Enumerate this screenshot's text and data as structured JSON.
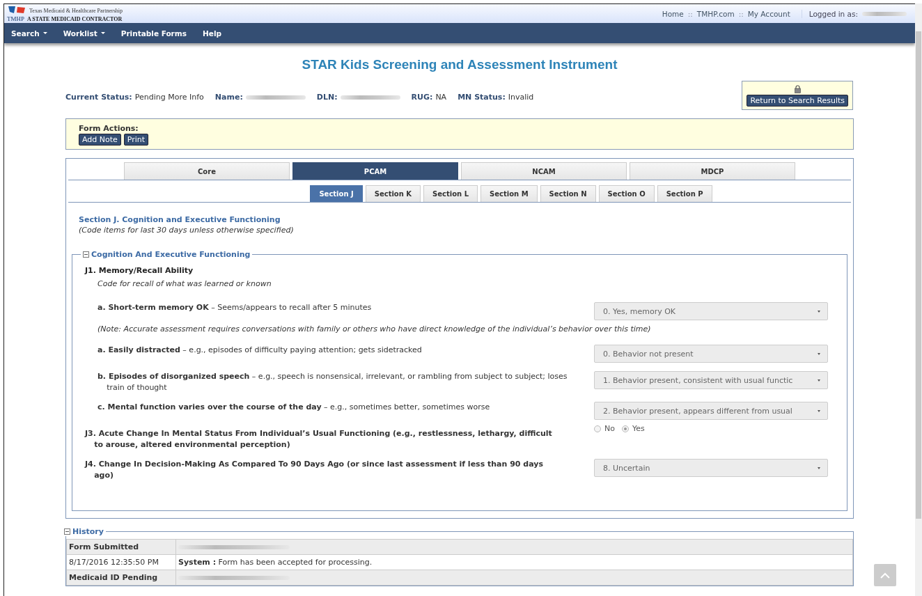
{
  "header": {
    "logo_mark": "TMHP",
    "logo_line1": "Texas Medicaid & Healthcare Partnership",
    "logo_line2": "A STATE MEDICAID CONTRACTOR",
    "links": [
      "Home",
      "TMHP.com",
      "My Account"
    ],
    "separator": "::",
    "logged_in_label": "Logged in as:"
  },
  "nav": [
    {
      "label": "Search",
      "dropdown": true
    },
    {
      "label": "Worklist",
      "dropdown": true
    },
    {
      "label": "Printable Forms",
      "dropdown": false
    },
    {
      "label": "Help",
      "dropdown": false
    }
  ],
  "title": "STAR Kids Screening and Assessment Instrument",
  "status": [
    {
      "label": "Current Status:",
      "value": "Pending More Info"
    },
    {
      "label": "Name:",
      "redacted": true
    },
    {
      "label": "DLN:",
      "redacted": true
    },
    {
      "label": "RUG:",
      "value": "NA"
    },
    {
      "label": "MN Status:",
      "value": "Invalid"
    }
  ],
  "return_button": "Return to Search Results",
  "form_actions": {
    "label": "Form Actions:",
    "buttons": [
      "Add Note",
      "Print"
    ]
  },
  "tabs": [
    {
      "label": "Core",
      "selected": false
    },
    {
      "label": "PCAM",
      "selected": true
    },
    {
      "label": "NCAM",
      "selected": false
    },
    {
      "label": "MDCP",
      "selected": false
    }
  ],
  "subtabs": [
    {
      "label": "Section J",
      "selected": true
    },
    {
      "label": "Section K",
      "selected": false
    },
    {
      "label": "Section L",
      "selected": false
    },
    {
      "label": "Section M",
      "selected": false
    },
    {
      "label": "Section N",
      "selected": false
    },
    {
      "label": "Section O",
      "selected": false
    },
    {
      "label": "Section P",
      "selected": false
    }
  ],
  "section": {
    "title": "Section J. Cognition and Executive Functioning",
    "subtitle": "(Code items for last 30 days unless otherwise specified)"
  },
  "fieldset": {
    "legend": "Cognition And Executive Functioning",
    "expanded": true,
    "items": [
      {
        "kind": "heading",
        "text": "**J1. Memory/Recall Ability**",
        "hint": "Code for recall of what was learned or known"
      },
      {
        "kind": "select",
        "text": "**a. Short-term memory OK** – Seems/appears to recall after 5 minutes",
        "value": "0. Yes, memory OK"
      },
      {
        "kind": "note",
        "text": "(Note: Accurate assessment requires conversations with family or others who have direct knowledge of the individual’s behavior over this time)"
      },
      {
        "kind": "select",
        "text": "**a. Easily distracted** – e.g., episodes of difficulty paying attention; gets sidetracked",
        "value": "0. Behavior not present"
      },
      {
        "kind": "select",
        "text": "**b. Episodes of disorganized speech** – e.g., speech is nonsensical, irrelevant, or rambling from subject to subject; loses train of thought",
        "value": "1. Behavior present, consistent with usual functic"
      },
      {
        "kind": "select",
        "text": "**c. Mental function varies over the course of the day** – e.g., sometimes better, sometimes worse",
        "value": "2. Behavior present, appears different from usual"
      },
      {
        "kind": "radio",
        "text": "**J3. Acute Change In Mental Status From Individual’s Usual Functioning (e.g., restlessness, lethargy, difficult to arouse, altered environmental perception)**",
        "options": [
          {
            "label": "No",
            "selected": false
          },
          {
            "label": "Yes",
            "selected": true
          }
        ]
      },
      {
        "kind": "question",
        "text": "**J4. Change In Decision-Making As Compared To 90 Days Ago (or since last assessment if less than 90 days ago)**",
        "value": "8. Uncertain"
      }
    ]
  },
  "history": {
    "legend": "History",
    "expanded": true,
    "rows": [
      {
        "label": "Form Submitted",
        "shaded": true,
        "redacted": true
      },
      {
        "label": "8/17/2016 12:35:50 PM",
        "shaded": false,
        "text": "**System :** Form has been accepted for processing."
      },
      {
        "label": "Medicaid ID Pending",
        "shaded": true,
        "redacted": true
      }
    ]
  }
}
